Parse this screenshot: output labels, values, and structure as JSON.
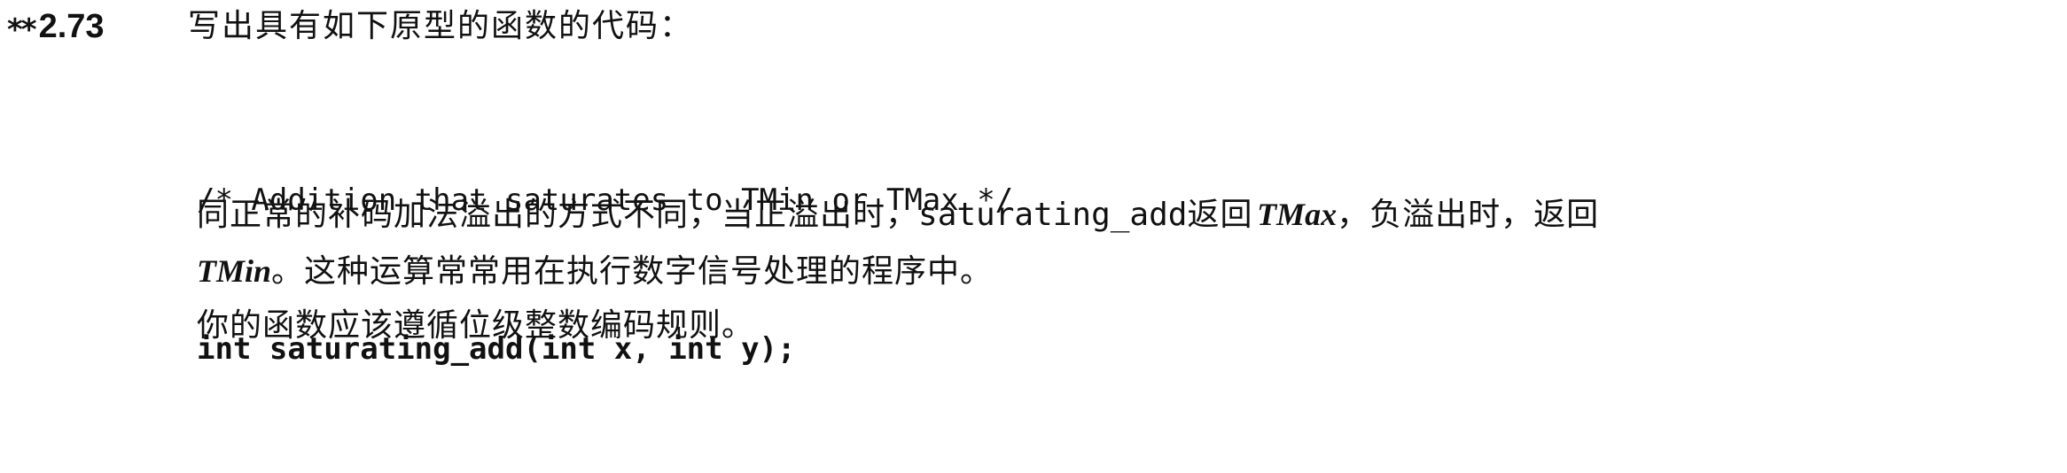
{
  "problem": {
    "stars": "**",
    "number": "2.73",
    "title": "写出具有如下原型的函数的代码："
  },
  "code": {
    "comment": "/* Addition that saturates to TMin or TMax */",
    "signature": "int saturating_add(int x, int y);"
  },
  "paragraph1": {
    "before": "同正常的补码加法溢出的方式不同，当正溢出时，",
    "func_name": "saturating_add",
    "middle": "返回",
    "tmax": "TMax",
    "after": "，负溢出时，返回"
  },
  "paragraph2": {
    "tmin": "TMin",
    "text": "。这种运算常常用在执行数字信号处理的程序中。"
  },
  "paragraph3": {
    "text": "你的函数应该遵循位级整数编码规则。"
  }
}
